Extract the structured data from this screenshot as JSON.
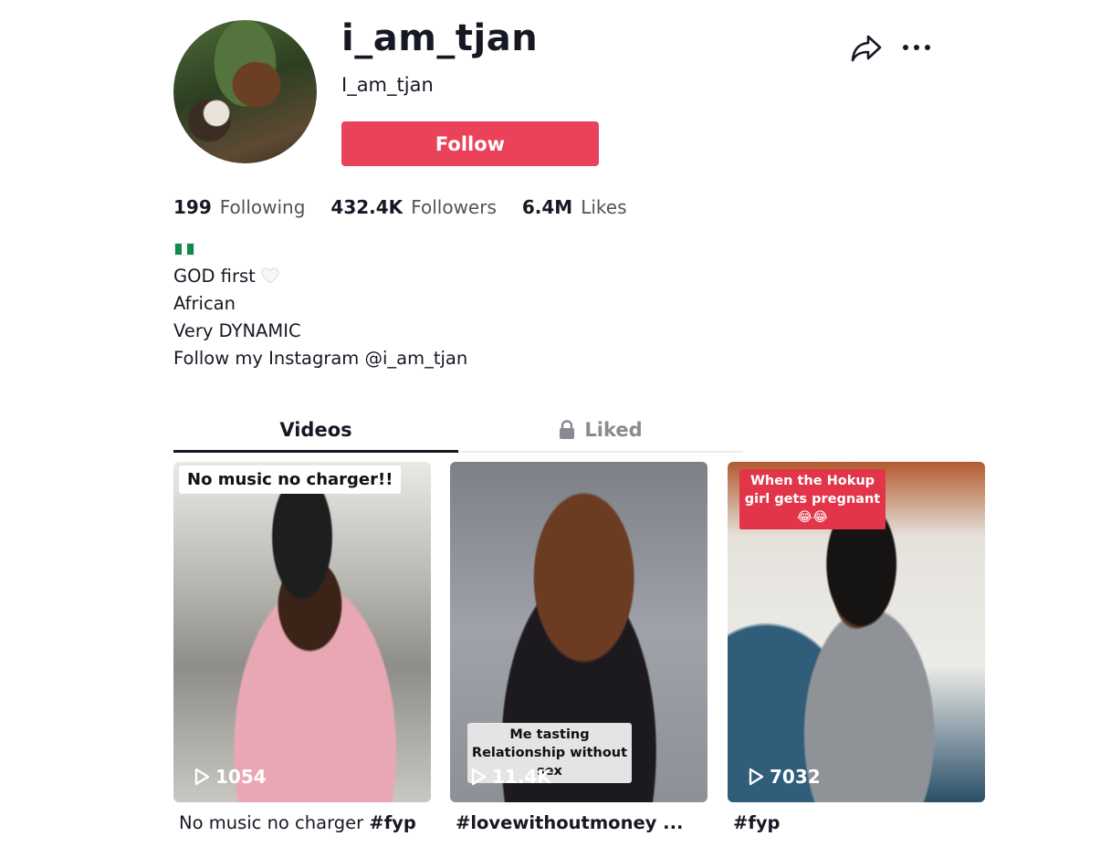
{
  "profile": {
    "username": "i_am_tjan",
    "nickname": "I_am_tjan",
    "follow_label": "Follow",
    "avatar_icon": "profile-avatar"
  },
  "stats": [
    {
      "count": "199",
      "label": "Following"
    },
    {
      "count": "432.4K",
      "label": "Followers"
    },
    {
      "count": "6.4M",
      "label": "Likes"
    }
  ],
  "bio": {
    "flag_icon": "nigeria-flag-icon",
    "lines": [
      "GOD first",
      "African",
      "Very DYNAMIC",
      "Follow my Instagram @i_am_tjan"
    ],
    "heart_icon": "white-heart-icon"
  },
  "header_icons": [
    "share-icon",
    "more-icon"
  ],
  "tabs": [
    {
      "label": "Videos",
      "active": true
    },
    {
      "label": "Liked",
      "icon": "lock-icon",
      "active": false
    }
  ],
  "videos": [
    {
      "overlay_caption": "No music no charger!!",
      "views": "1054",
      "desc_text": "No music no charger",
      "desc_tag": "#fyp"
    },
    {
      "overlay_caption": "Me tasting Relationship without sex",
      "views": "11.4K",
      "desc_text": "#lovewithoutmoney ..."
    },
    {
      "overlay_caption": "When the Hokup girl gets pregnant 😂😂",
      "views": "7032",
      "desc_text": "#fyp"
    }
  ],
  "colors": {
    "follow_button": "#ea4359",
    "text_primary": "#161823",
    "text_secondary": "#50525b",
    "tab_inactive": "#8a8b91"
  }
}
